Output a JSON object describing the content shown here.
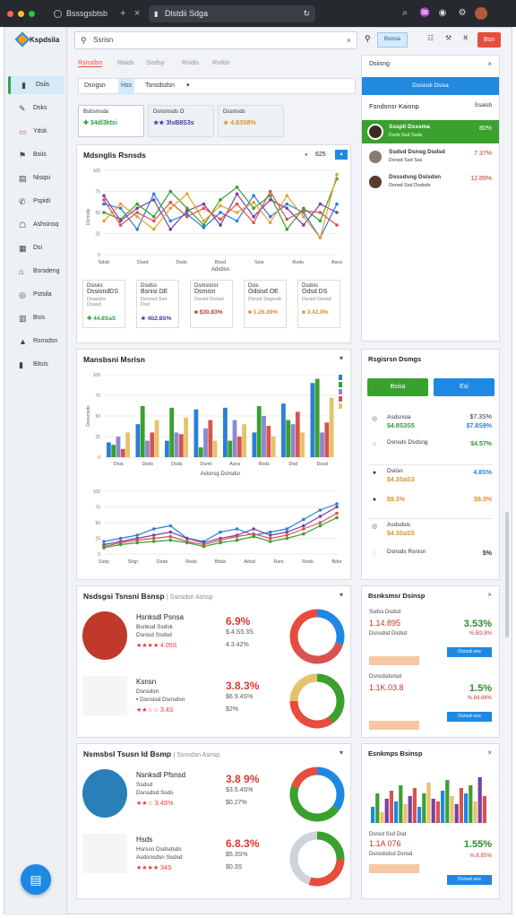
{
  "browser": {
    "tab_title": "Bsssgsbtsb",
    "url": "Dlstdii Sdga",
    "new_tab": "+",
    "close_tab": "×"
  },
  "sidebar": {
    "brand": "Kspdsiia",
    "items": [
      {
        "label": "Dsiis",
        "icon": "▮",
        "active": true
      },
      {
        "label": "Dsks",
        "icon": "✎"
      },
      {
        "label": "Ydsk",
        "icon": "▭",
        "red": true
      },
      {
        "label": "Bsiis",
        "icon": "⚑"
      },
      {
        "label": "Nisqsi",
        "icon": "▤"
      },
      {
        "label": "Pspidi",
        "icon": "✆"
      },
      {
        "label": "Ashsinsq",
        "icon": "☖"
      },
      {
        "label": "Dsi",
        "icon": "▦"
      },
      {
        "label": "Bsrsdeng",
        "icon": "⌂"
      },
      {
        "label": "Pstsila",
        "icon": "◎"
      },
      {
        "label": "Bsis",
        "icon": "▥"
      },
      {
        "label": "Rsnsdsn",
        "icon": "▲"
      },
      {
        "label": "Bitsis",
        "icon": "▮"
      }
    ],
    "fab_icon": "▤"
  },
  "search": {
    "placeholder": "Ssrisn",
    "icon": "⚲",
    "clear": "×"
  },
  "search2": {
    "chip": "Bsnsia",
    "icons": [
      "⚲",
      "☷",
      "⚒",
      "Ӿ"
    ],
    "red_btn": "Bsn"
  },
  "tabs": [
    "Rsnsdsn",
    "Maids",
    "Sisdsy",
    "Rsidis",
    "Rsrkis"
  ],
  "filters": {
    "a": "Dsngsn",
    "b": "Hss",
    "c": "Tsnsdsdsn",
    "chevron": "▾"
  },
  "kpis": [
    {
      "title": "Bsbsmsda",
      "value": "✚ 34dl3ktsi",
      "color": "#2e9a3e"
    },
    {
      "title": "Dsnsmsds O",
      "value": "★★ 3lsB8S3s",
      "color": "#3b3ba6"
    },
    {
      "title": "Dssmsds",
      "value": "★ 4.83S8%",
      "color": "#d9902a"
    }
  ],
  "trend": {
    "title": "Mdsnglis Rsnsds",
    "value": "625",
    "badge": "▴",
    "ylabel": "Dsmsds"
  },
  "chart_data": [
    {
      "type": "line",
      "title": "Mdsnglis Rsnsds",
      "xlabel": "Adsbsn",
      "categories": [
        "Sdsb",
        "Dssd",
        "Dsds",
        "Bssd",
        "Ssis",
        "Rsds",
        "Asns"
      ],
      "ylim": [
        0,
        100
      ],
      "series": [
        {
          "values": [
            60,
            55,
            30,
            72,
            40,
            48,
            32,
            50,
            40,
            70,
            45,
            60,
            50,
            20,
            60
          ],
          "color": "#2a7fd6"
        },
        {
          "values": [
            50,
            42,
            60,
            45,
            75,
            55,
            35,
            65,
            80,
            55,
            70,
            30,
            55,
            40,
            90
          ],
          "color": "#3aa02e"
        },
        {
          "values": [
            70,
            40,
            55,
            65,
            30,
            52,
            60,
            35,
            72,
            45,
            65,
            55,
            35,
            60,
            50
          ],
          "color": "#7b3fa0"
        },
        {
          "values": [
            40,
            60,
            45,
            30,
            55,
            72,
            40,
            58,
            50,
            62,
            38,
            70,
            45,
            20,
            95
          ],
          "color": "#e6a32b"
        },
        {
          "values": [
            65,
            35,
            50,
            40,
            62,
            45,
            55,
            42,
            60,
            38,
            75,
            42,
            52,
            50,
            35
          ],
          "color": "#d9534f"
        }
      ]
    },
    {
      "type": "bar",
      "title": "Mansbsni Msrisn",
      "xlabel": "Aslsnsg Dsnsdsr",
      "categories": [
        "Dsia",
        "Dsds",
        "Dsds",
        "Dsmt",
        "Asns",
        "Rsds",
        "Dsd",
        "Dssd"
      ],
      "ylim": [
        0,
        100
      ],
      "series": [
        {
          "values": [
            18,
            40,
            20,
            58,
            60,
            30,
            65,
            90
          ],
          "color": "#2a7fd6"
        },
        {
          "values": [
            15,
            62,
            60,
            12,
            20,
            62,
            45,
            95
          ],
          "color": "#3aa02e"
        },
        {
          "values": [
            25,
            20,
            30,
            35,
            45,
            50,
            40,
            30
          ],
          "color": "#8a8ad0"
        },
        {
          "values": [
            10,
            30,
            28,
            45,
            25,
            38,
            55,
            42
          ],
          "color": "#d9534f"
        },
        {
          "values": [
            30,
            45,
            48,
            20,
            40,
            25,
            30,
            72
          ],
          "color": "#e6c36b"
        }
      ]
    },
    {
      "type": "line",
      "categories": [
        "Ssdy",
        "Shgr",
        "Dsds",
        "Rsds",
        "Bdsk",
        "Adsd",
        "Rsrs",
        "Rsds",
        "Bdsr"
      ],
      "ylim": [
        0,
        100
      ],
      "series": [
        {
          "values": [
            20,
            25,
            30,
            40,
            45,
            25,
            20,
            35,
            40,
            30,
            35,
            40,
            55,
            70,
            80
          ],
          "color": "#2a7fd6"
        },
        {
          "values": [
            15,
            20,
            25,
            30,
            35,
            25,
            18,
            25,
            30,
            40,
            30,
            35,
            45,
            60,
            75
          ],
          "color": "#7b3fa0"
        },
        {
          "values": [
            12,
            18,
            22,
            25,
            28,
            20,
            15,
            22,
            28,
            32,
            25,
            30,
            40,
            50,
            65
          ],
          "color": "#d9534f"
        },
        {
          "values": [
            10,
            15,
            18,
            20,
            22,
            18,
            12,
            18,
            22,
            28,
            20,
            25,
            32,
            45,
            58
          ],
          "color": "#3aa02e"
        }
      ]
    }
  ],
  "minicards": [
    {
      "l1": "Dsisks",
      "l2": "DssiondDS",
      "l3": "Dsasdss Dsasd",
      "l4": "✚ 44.8SaS",
      "color": "#2e9a3e"
    },
    {
      "l1": "Dsidss",
      "l2": "Bsnisi DE",
      "l3": "Dsnssd Ssd Dsd",
      "l4": "★ 4b2.8S%",
      "color": "#3b3ba6"
    },
    {
      "l1": "Dsmsisrsr",
      "l2": "Dsmisn",
      "l3": "Dsnsd Dsnsd",
      "l4": "■ $30.83%",
      "color": "#c0392b"
    },
    {
      "l1": "Dsis",
      "l2": "Odsisd OE",
      "l3": "Dsnsd Ssgsrsb",
      "l4": "■ 1.26.89%",
      "color": "#d9902a"
    },
    {
      "l1": "Dsdsis",
      "l2": "Odsd DS",
      "l3": "Dsnsd Dsnsd",
      "l4": "■ 3.42.8%",
      "color": "#d9902a"
    }
  ],
  "bars_panel": {
    "title": "Mansbsni Msrisn",
    "ylabel": "Dsnsmsds",
    "xlabel": "Aslsnsg Dsnsdsr"
  },
  "dialog": {
    "title": "Dsiisng",
    "close": "×",
    "bar": "Dsisisdi Dsisa",
    "header_l": "Fsndsnsr Kaisnp",
    "header_r": "Ssaisb",
    "rows": [
      {
        "name": "Ssspli Dsssma",
        "sub": "Dsds Ssd Ssds",
        "pct": "80%",
        "highlight": true
      },
      {
        "name": "Ssdsd Dsnsg Dsdsd",
        "sub": "Dsnsd Ssd Sss",
        "pct": "7.37%"
      },
      {
        "name": "Dsssdsng Dslsdsn",
        "sub": "Dsnsd Ssd Dsdsds",
        "pct": "12.89%"
      }
    ]
  },
  "rp_panel": {
    "title": "Rsgisrsn Dsmgs",
    "btn_green": "Bsisa",
    "btn_blue": "Esi",
    "items": [
      {
        "l1": "Asdsnsia",
        "l2": "$4.8S3S5",
        "r1": "$7.3S%",
        "r2": "$7.8S9%",
        "icon": "◎",
        "l2c": "#2e9a3e",
        "r2c": "#2a7fd6"
      },
      {
        "l1": "Dsnsds Dsdsng",
        "l2": "",
        "r1": "",
        "r2": "$4.57%",
        "icon": "○",
        "l2c": "#333",
        "r2c": "#2e9a3e"
      },
      {
        "l1": "Dsiisn",
        "l2": "$4.3SaS3",
        "r1": "",
        "r2": "4.8S%",
        "icon": "●",
        "l2c": "#d9902a",
        "r2c": "#2a7fd6"
      },
      {
        "l1": "",
        "l2": "$9.3%",
        "r1": "",
        "r2": "$9.3%",
        "icon": "●",
        "l2c": "#d9902a",
        "r2c": "#d9902a"
      },
      {
        "l1": "Asdsdsls",
        "l2": "$4.3SaS5",
        "r1": "",
        "r2": "",
        "icon": "◎",
        "l2c": "#d9902a",
        "r2c": "#333"
      },
      {
        "l1": "Dsnsds Rsnisn",
        "l2": "",
        "r1": "",
        "r2": "$%",
        "icon": "◌",
        "l2c": "#2e9a3e",
        "r2c": "#333"
      }
    ]
  },
  "deal1": {
    "title": "Nsdsgsi Tsnsni Bsnsp",
    "subtitle": "| Ssnsdsn Asnsp",
    "rows": [
      {
        "name": "Hsnksdl Psnsa",
        "sub1": "Bsnksd Ssdsk",
        "sub2": "Dsnisd Ssdsd",
        "stars": "★★★★ 4.05S",
        "pct": "6.9%",
        "small1": "$.4.S5 3S",
        "small2": "4.3.42%"
      },
      {
        "name": "Ksnsn",
        "sub1": "Dsnsdsn",
        "sub2": "▪ Dsnsisd Dsnsdsn",
        "stars": "★★☆☆ 3.4S",
        "pct": "3.8.3%",
        "small1": "$6.9.4S%",
        "small2": "$2%"
      }
    ]
  },
  "deal2": {
    "title": "Nsmsbsl Tsusn Id Bsmp",
    "subtitle": "| Ssnsdsn Asnsp",
    "rows": [
      {
        "name": "Nsnksdl Pfsnsd",
        "sub1": "Ssdsd",
        "sub2": "Dsnsdsd Ssds",
        "stars": "★★☆ 3.4S%",
        "pct": "3.8 9%",
        "small1": "$3.5.4S%",
        "small2": "$0.27%"
      },
      {
        "name": "Hsds",
        "sub1": "Hsrssn Dsdsdsds",
        "sub2": "Asdsnsdsn Ssdsd",
        "stars": "★★★★ 34S",
        "pct": "6.8.3%",
        "small1": "$5.3S%",
        "small2": "$0.3S"
      }
    ]
  },
  "rt1": {
    "title": "Bsnksmsr Dsinsp",
    "rows": [
      {
        "num": "1.14.895",
        "sub1": "Ssdss Dsdsd",
        "sub2": "Dsnsdsd Dsdsd",
        "pct": "3.53%",
        "sub3": "%.5l3.8%",
        "btn": "Dsnsd sns"
      },
      {
        "num": "1.1K.03.8",
        "sub1": "Dsnsdsdsnsd",
        "sub2": "",
        "pct": "1.5%",
        "sub3": "%.84.88%",
        "btn": "Dsnsd sns"
      }
    ]
  },
  "rt2": {
    "title": "Esnkmps Bsinsp",
    "num": "1.1A 076",
    "sub1": "Dsnsd Ssd Dsd",
    "sub2": "Dsnsdsdsd Dsnsd",
    "pct": "1.55%",
    "sub3": "%.8.8S%",
    "btn": "Dsnsd sns",
    "bar_values": [
      30,
      55,
      20,
      45,
      60,
      40,
      70,
      35,
      50,
      65,
      30,
      55,
      75,
      45,
      40,
      60,
      80,
      50,
      35,
      65,
      55,
      70,
      40,
      85,
      50
    ]
  },
  "colors": {
    "green": "#3aa02e",
    "blue": "#1e88e5",
    "red": "#e74c3c",
    "orange": "#d9902a"
  }
}
